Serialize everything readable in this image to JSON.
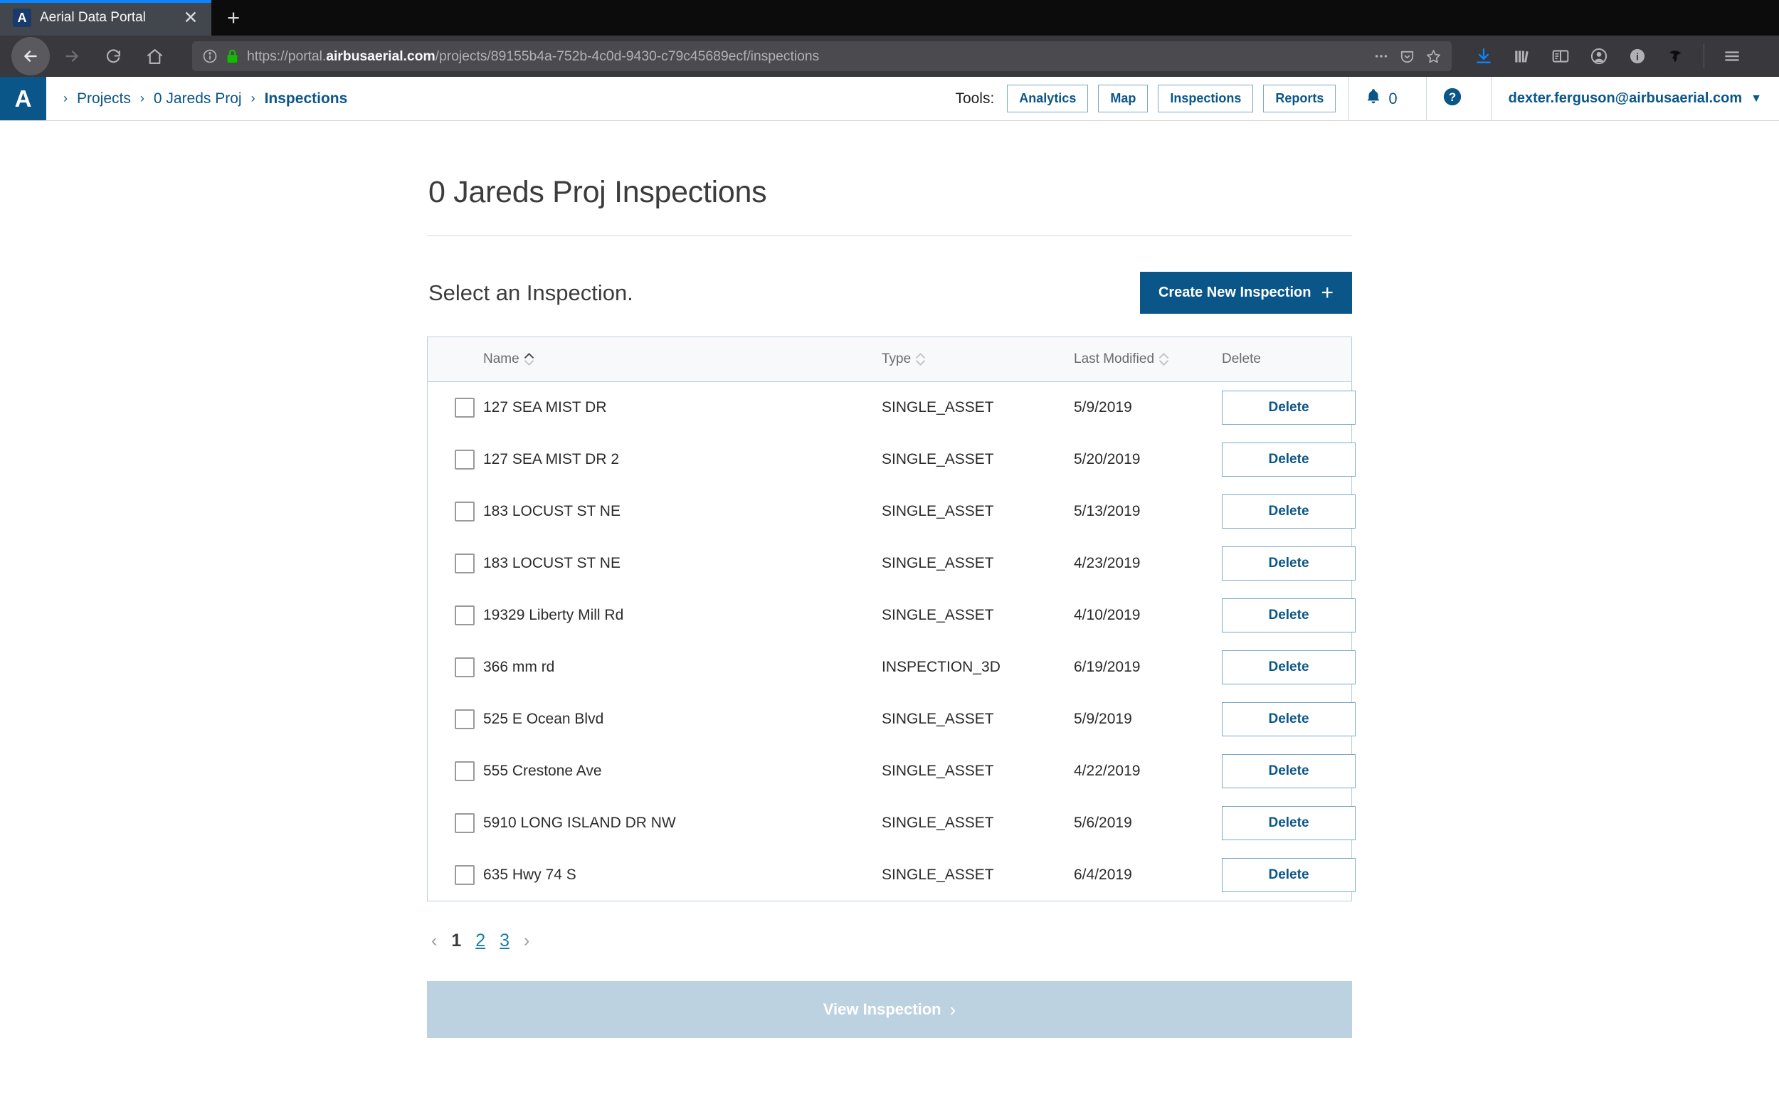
{
  "browser": {
    "tab": {
      "title": "Aerial Data Portal",
      "favicon_letter": "A",
      "close_icon": "close-icon"
    },
    "new_tab_label": "+",
    "url": {
      "prefix": "https://portal.",
      "domain": "airbusaerial.com",
      "path": "/projects/89155b4a-752b-4c0d-9430-c79c45689ecf/inspections",
      "full": "https://portal.airbusaerial.com/projects/89155b4a-752b-4c0d-9430-c79c45689ecf/inspections"
    }
  },
  "appheader": {
    "logo_letter": "A",
    "breadcrumb": [
      {
        "label": "Projects",
        "current": false
      },
      {
        "label": "0 Jareds Proj",
        "current": false
      },
      {
        "label": "Inspections",
        "current": true
      }
    ],
    "tools_label": "Tools:",
    "tools": [
      {
        "label": "Analytics"
      },
      {
        "label": "Map"
      },
      {
        "label": "Inspections"
      },
      {
        "label": "Reports"
      }
    ],
    "notification_count": "0",
    "user_email": "dexter.ferguson@airbusaerial.com",
    "user_caret": "▼"
  },
  "main": {
    "page_title": "0 Jareds Proj Inspections",
    "subtitle": "Select an Inspection.",
    "create_button": "Create New Inspection",
    "create_button_plus": "+",
    "view_button": "View Inspection",
    "view_button_chevron": "›"
  },
  "table": {
    "columns": [
      {
        "key": "check",
        "label": "",
        "sortable": false
      },
      {
        "key": "name",
        "label": "Name",
        "sortable": true,
        "sort_active": "asc"
      },
      {
        "key": "type",
        "label": "Type",
        "sortable": true,
        "sort_active": "none"
      },
      {
        "key": "modified",
        "label": "Last Modified",
        "sortable": true,
        "sort_active": "none"
      },
      {
        "key": "delete",
        "label": "Delete",
        "sortable": false
      }
    ],
    "delete_label": "Delete",
    "rows": [
      {
        "name": "127 SEA MIST DR",
        "type": "SINGLE_ASSET",
        "modified": "5/9/2019",
        "checked": false
      },
      {
        "name": "127 SEA MIST DR 2",
        "type": "SINGLE_ASSET",
        "modified": "5/20/2019",
        "checked": false
      },
      {
        "name": "183 LOCUST ST NE",
        "type": "SINGLE_ASSET",
        "modified": "5/13/2019",
        "checked": false
      },
      {
        "name": "183 LOCUST ST NE",
        "type": "SINGLE_ASSET",
        "modified": "4/23/2019",
        "checked": false
      },
      {
        "name": "19329 Liberty Mill Rd",
        "type": "SINGLE_ASSET",
        "modified": "4/10/2019",
        "checked": false
      },
      {
        "name": "366 mm rd",
        "type": "INSPECTION_3D",
        "modified": "6/19/2019",
        "checked": false
      },
      {
        "name": "525 E Ocean Blvd",
        "type": "SINGLE_ASSET",
        "modified": "5/9/2019",
        "checked": false
      },
      {
        "name": "555 Crestone Ave",
        "type": "SINGLE_ASSET",
        "modified": "4/22/2019",
        "checked": false
      },
      {
        "name": "5910 LONG ISLAND DR NW",
        "type": "SINGLE_ASSET",
        "modified": "5/6/2019",
        "checked": false
      },
      {
        "name": "635 Hwy 74 S",
        "type": "SINGLE_ASSET",
        "modified": "6/4/2019",
        "checked": false
      }
    ]
  },
  "pagination": {
    "prev": "‹",
    "next": "›",
    "pages": [
      {
        "label": "1",
        "active": true
      },
      {
        "label": "2",
        "active": false
      },
      {
        "label": "3",
        "active": false
      }
    ]
  },
  "colors": {
    "brand_blue": "#0b5688",
    "link_blue": "#1a7fa8",
    "disabled_button": "#bcd2e0",
    "table_border": "#b9cfdd",
    "header_bg": "#f7f9fa",
    "chrome_dark": "#38383d",
    "tabstrip_black": "#0c0c0d",
    "tab_active": "#42464d",
    "tab_accent": "#0a84ff"
  }
}
